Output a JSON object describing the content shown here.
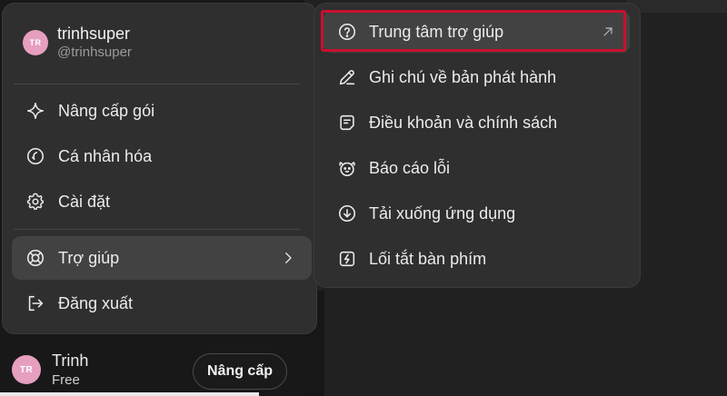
{
  "user": {
    "initials": "TR",
    "name": "trinhsuper",
    "handle": "@trinhsuper"
  },
  "menu": {
    "upgrade": {
      "label": "Nâng cấp gói",
      "icon": "sparkle-icon"
    },
    "personalize": {
      "label": "Cá nhân hóa",
      "icon": "personalize-icon"
    },
    "settings": {
      "label": "Cài đặt",
      "icon": "gear-icon"
    },
    "help": {
      "label": "Trợ giúp",
      "icon": "lifebuoy-icon"
    },
    "logout": {
      "label": "Đăng xuất",
      "icon": "logout-icon"
    }
  },
  "submenu": {
    "help_center": {
      "label": "Trung tâm trợ giúp",
      "icon": "question-circle-icon"
    },
    "release_notes": {
      "label": "Ghi chú về bản phát hành",
      "icon": "pencil-icon"
    },
    "terms": {
      "label": "Điều khoản và chính sách",
      "icon": "document-icon"
    },
    "bug_report": {
      "label": "Báo cáo lỗi",
      "icon": "bug-icon"
    },
    "download_apps": {
      "label": "Tải xuống ứng dụng",
      "icon": "download-circle-icon"
    },
    "shortcuts": {
      "label": "Lối tắt bàn phím",
      "icon": "lightning-icon"
    }
  },
  "account": {
    "initials": "TR",
    "name": "Trinh",
    "plan": "Free",
    "upgrade_label": "Nâng cấp"
  },
  "colors": {
    "highlight": "#c8102e",
    "avatar": "#e79fc0",
    "menu_bg": "#2f2f2f",
    "hover_bg": "#424242"
  }
}
